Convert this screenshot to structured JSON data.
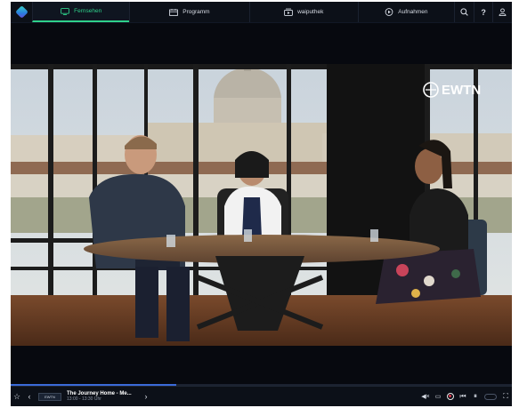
{
  "nav": {
    "tabs": [
      {
        "label": "Fernsehen",
        "icon": "tv-icon",
        "active": true
      },
      {
        "label": "Programm",
        "icon": "guide-icon",
        "active": false
      },
      {
        "label": "waiputhek",
        "icon": "mediathek-icon",
        "active": false
      },
      {
        "label": "Aufnahmen",
        "icon": "record-icon",
        "active": false
      }
    ],
    "right_icons": [
      "search-icon",
      "help-icon",
      "account-icon"
    ],
    "help_label": "?"
  },
  "video": {
    "channel_watermark": "EWTN"
  },
  "player": {
    "channel_logo": "EWTN",
    "show_title": "The Journey Home - Me...",
    "show_time": "13:00 - 13:30 Uhr",
    "progress_fraction": 0.33,
    "colors": {
      "accent": "#2fd08a",
      "record": "#e0364a",
      "progress": "#3a6ad8"
    }
  }
}
